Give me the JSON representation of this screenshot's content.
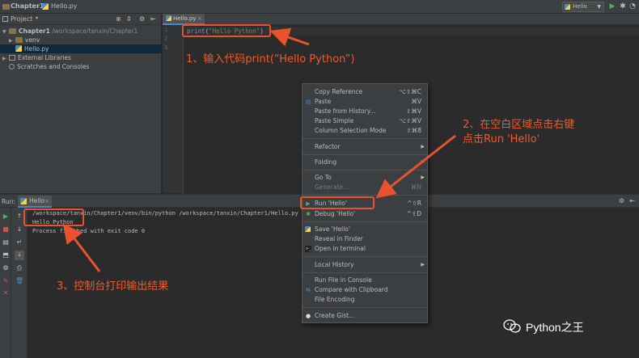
{
  "navbar": {
    "crumbs": [
      "Chapter1",
      "Hello.py"
    ],
    "run_config": "Hello"
  },
  "project": {
    "header": "Project",
    "tree": [
      {
        "label": "Chapter1",
        "path": "/workspace/tanxin/Chapter1",
        "kind": "folder"
      },
      {
        "label": "venv",
        "kind": "folder"
      },
      {
        "label": "Hello.py",
        "kind": "py"
      },
      {
        "label": "External Libraries",
        "kind": "lib"
      },
      {
        "label": "Scratches and Consoles",
        "kind": "scratch"
      }
    ]
  },
  "editor": {
    "tab": "Hello.py",
    "line_numbers": [
      "1",
      "2",
      "3"
    ],
    "code": {
      "fn": "print",
      "open": "(",
      "str": "\"Hello Python\"",
      "close": ")"
    }
  },
  "run": {
    "label": "Run:",
    "tab": "Hello",
    "console_lines": [
      "/workspace/tanxin/Chapter1/venv/bin/python /workspace/tanxin/Chapter1/Hello.py",
      "Hello Python",
      "",
      "Process finished with exit code 0"
    ]
  },
  "context_menu": {
    "items": [
      {
        "label": "Copy Reference",
        "shortcut": "⌥⇧⌘C"
      },
      {
        "label": "Paste",
        "shortcut": "⌘V",
        "icon": "paste-icon"
      },
      {
        "label": "Paste from History...",
        "shortcut": "⇧⌘V"
      },
      {
        "label": "Paste Simple",
        "shortcut": "⌥⇧⌘V"
      },
      {
        "label": "Column Selection Mode",
        "shortcut": "⇧⌘8"
      },
      {
        "label": "Refactor",
        "submenu": true
      },
      {
        "label": "Folding",
        "submenu": true
      },
      {
        "label": "Go To",
        "submenu": true
      },
      {
        "label": "Generate...",
        "shortcut": "⌘N",
        "disabled": true
      },
      {
        "label": "Run 'Hello'",
        "shortcut": "^⇧R",
        "icon": "run-icon"
      },
      {
        "label": "Debug 'Hello'",
        "shortcut": "^⇧D",
        "icon": "debug-icon"
      },
      {
        "label": "Save 'Hello'",
        "icon": "python-icon"
      },
      {
        "label": "Reveal in Finder"
      },
      {
        "label": "Open in terminal",
        "icon": "terminal-icon"
      },
      {
        "label": "Local History",
        "submenu": true
      },
      {
        "label": "Run File in Console"
      },
      {
        "label": "Compare with Clipboard",
        "icon": "compare-icon"
      },
      {
        "label": "File Encoding"
      },
      {
        "label": "Create Gist...",
        "icon": "github-icon"
      }
    ]
  },
  "annotations": {
    "step1": "1、输入代码print(“Hello Python”)",
    "step2_line1": "2、在空白区域点击右键",
    "step2_line2": "点击Run 'Hello'",
    "step3": "3、控制台打印输出结果"
  },
  "watermark": "Python之王",
  "colors": {
    "accent": "#e8522d",
    "background": "#2b2b2b",
    "panel": "#3c3f41"
  }
}
